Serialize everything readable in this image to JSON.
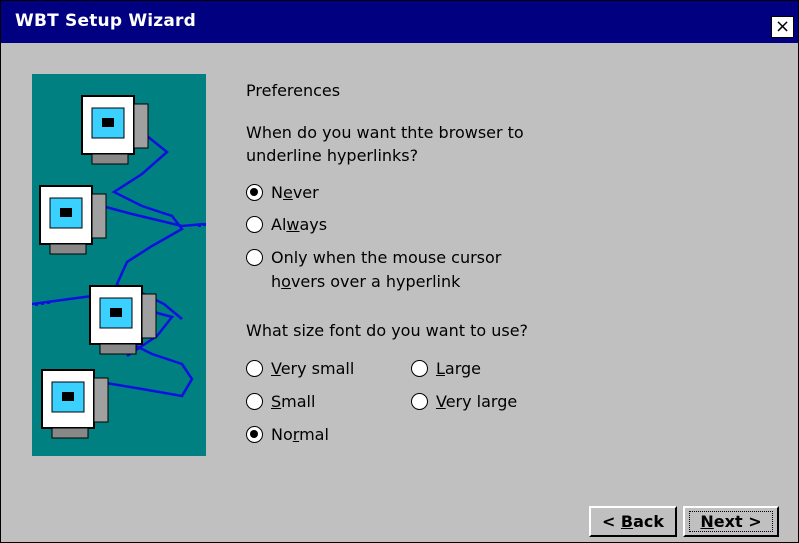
{
  "window": {
    "title": "WBT Setup Wizard",
    "close_glyph": "×"
  },
  "illustration": {
    "icon": "networked-computers-illustration"
  },
  "preferences": {
    "heading": "Preferences",
    "q1_line1": "When do you want thte browser to",
    "q1_line2": "underline hyperlinks?",
    "underline_options": [
      {
        "pre": "N",
        "u": "e",
        "post": "ver",
        "selected": true
      },
      {
        "pre": "Al",
        "u": "w",
        "post": "ays",
        "selected": false
      },
      {
        "line1": "Only when the mouse cursor",
        "line2_pre": "h",
        "line2_u": "o",
        "line2_post": "vers over a hyperlink",
        "selected": false
      }
    ],
    "q2": "What size font do you want to use?",
    "font_options": [
      {
        "pre": "",
        "u": "V",
        "post": "ery small",
        "selected": false
      },
      {
        "pre": "",
        "u": "S",
        "post": "mall",
        "selected": false
      },
      {
        "pre": "No",
        "u": "r",
        "post": "mal",
        "selected": true
      },
      {
        "pre": "",
        "u": "L",
        "post": "arge",
        "selected": false
      },
      {
        "pre": "",
        "u": "V",
        "post": "ery large",
        "selected": false
      }
    ]
  },
  "buttons": {
    "back": {
      "pre": "< ",
      "u": "B",
      "post": "ack"
    },
    "next": {
      "pre": "",
      "u": "N",
      "post": "ext >"
    }
  }
}
